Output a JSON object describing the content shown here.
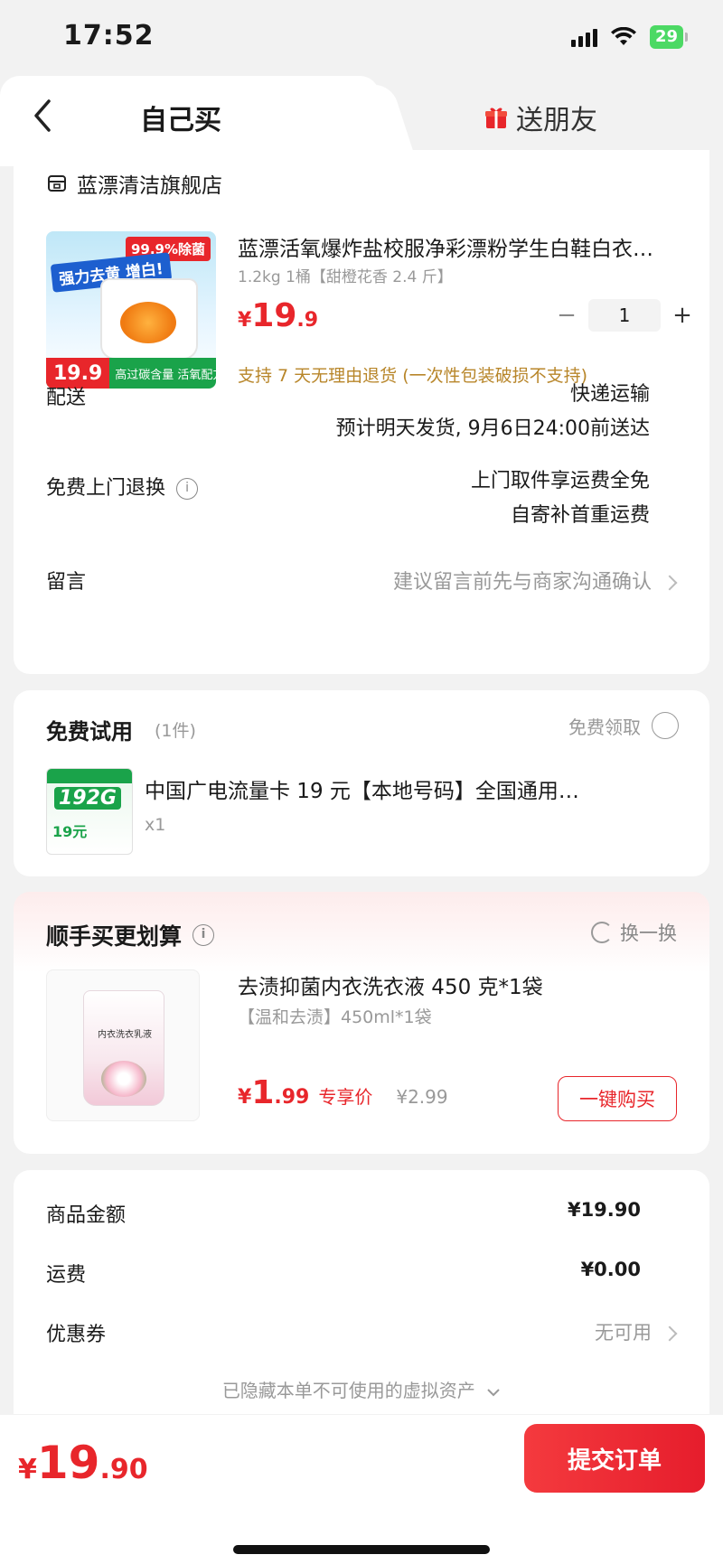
{
  "status_bar": {
    "time": "17:52",
    "battery": "29"
  },
  "tabs": {
    "self_buy": "自己买",
    "gift": "送朋友"
  },
  "store": {
    "name": "蓝漂清洁旗舰店"
  },
  "product": {
    "image_badge": "99.9%除菌",
    "image_tag": "强力去黄 增白!",
    "image_price": "19.9",
    "image_bottom_text": "高过碳含量 活氧配方",
    "title": "蓝漂活氧爆炸盐校服净彩漂粉学生白鞋白衣…",
    "spec": "1.2kg 1桶【甜橙花香 2.4 斤】",
    "price_symbol": "¥",
    "price_int": "19",
    "price_dec": ".9",
    "quantity": "1",
    "minus": "−",
    "plus": "+",
    "return_note": "支持 7 天无理由退货 (一次性包装破损不支持)"
  },
  "delivery": {
    "label": "配送",
    "method": "快递运输",
    "eta": "预计明天发货, 9月6日24:00前送达"
  },
  "free_return": {
    "label": "免费上门退换",
    "line1": "上门取件享运费全免",
    "line2": "自寄补首重运费"
  },
  "message": {
    "label": "留言",
    "placeholder": "建议留言前先与商家沟通确认"
  },
  "trial": {
    "title": "免费试用",
    "count": "(1件)",
    "claim": "免费领取",
    "image_big": "192G",
    "image_low": "19元",
    "name": "中国广电流量卡 19 元【本地号码】全国通用…",
    "qty": "x1"
  },
  "addon": {
    "title": "顺手买更划算",
    "swap": "换一换",
    "image_label": "内衣洗衣乳液",
    "name": "去渍抑菌内衣洗衣液 450 克*1袋",
    "spec": "【温和去渍】450ml*1袋",
    "price_symbol": "¥",
    "price_int": "1",
    "price_dec": ".99",
    "exclusive": "专享价",
    "original_price": "¥2.99",
    "buy_button": "一键购买"
  },
  "summary": {
    "goods_label": "商品金额",
    "goods_value": "¥19.90",
    "shipping_label": "运费",
    "shipping_value": "¥0.00",
    "coupon_label": "优惠券",
    "coupon_value": "无可用",
    "hidden_assets": "已隐藏本单不可使用的虚拟资产"
  },
  "footer": {
    "total_symbol": "¥",
    "total_int": "19",
    "total_dec": ".90",
    "submit": "提交订单"
  },
  "colors": {
    "accent": "#e8262b",
    "promo_green": "#1aa34a",
    "return_note": "#b8862a"
  }
}
